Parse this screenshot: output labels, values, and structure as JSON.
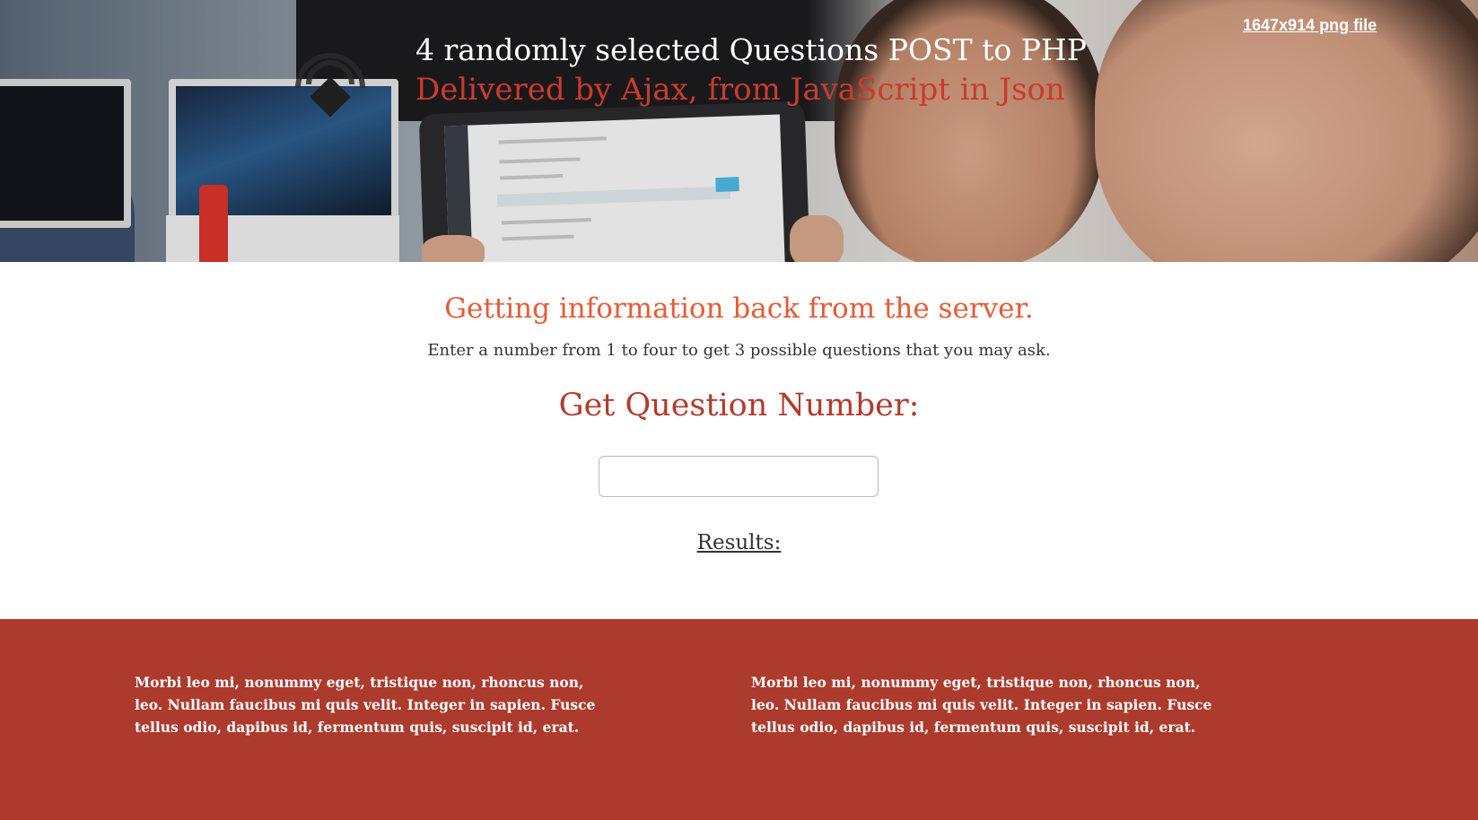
{
  "hero": {
    "title": "4 randomly selected Questions POST to PHP",
    "subtitle": "Delivered by Ajax, from JavaScript in Json",
    "png_link": "1647x914 png file",
    "logo_icon": "location-pin-logo-icon"
  },
  "main": {
    "section_title": "Getting information back from the server.",
    "instructions": "Enter a number from 1 to four to get 3 possible questions that you may ask.",
    "question_label": "Get Question Number:",
    "question_input_value": "",
    "results_label": "Results:"
  },
  "footer": {
    "columns": [
      "Morbi leo mi, nonummy eget, tristique non, rhoncus non, leo. Nullam faucibus mi quis velit. Integer in sapien. Fusce tellus odio, dapibus id, fermentum quis, suscipit id, erat.",
      "Morbi leo mi, nonummy eget, tristique non, rhoncus non, leo. Nullam faucibus mi quis velit. Integer in sapien. Fusce tellus odio, dapibus id, fermentum quis, suscipit id, erat."
    ]
  },
  "colors": {
    "accent_orange": "#e65b36",
    "accent_red": "#b33b2c",
    "footer_bg": "#ad3b2d",
    "subtitle_red": "#cc3b2c"
  }
}
